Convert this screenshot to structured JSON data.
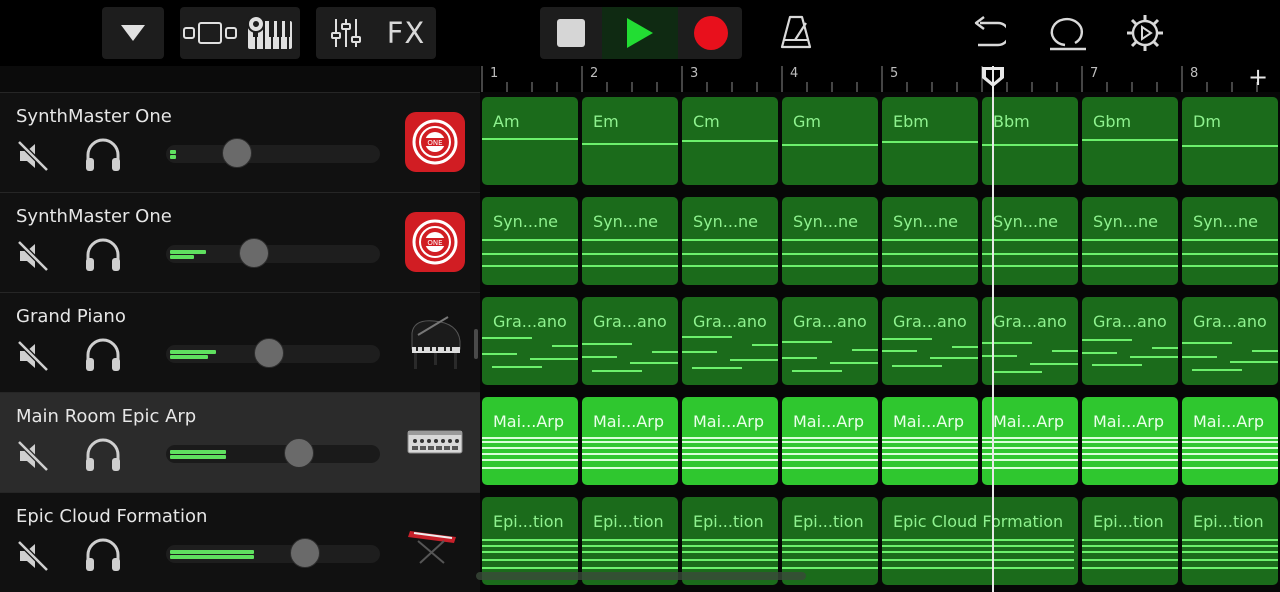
{
  "toolbar": {
    "fx_label": "FX",
    "colors": {
      "record": "#e8101c",
      "play": "#22dd33",
      "region": "#1b6b1b",
      "region_selected": "#2fc72f"
    }
  },
  "ruler": {
    "bars": [
      "1",
      "2",
      "3",
      "4",
      "5",
      "6",
      "7",
      "8"
    ],
    "add_label": "+"
  },
  "tracks": [
    {
      "name": "SynthMaster One",
      "icon": "synthmaster-one-icon",
      "selected": false,
      "volume": 0.33
    },
    {
      "name": "SynthMaster One",
      "icon": "synthmaster-one-icon",
      "selected": false,
      "volume": 0.41
    },
    {
      "name": "Grand Piano",
      "icon": "grand-piano-icon",
      "selected": false,
      "volume": 0.48
    },
    {
      "name": "Main Room Epic Arp",
      "icon": "synth-module-icon",
      "selected": true,
      "volume": 0.62
    },
    {
      "name": "Epic Cloud Formation",
      "icon": "keyboard-stand-icon",
      "selected": false,
      "volume": 0.65
    }
  ],
  "regions": [
    [
      "Am",
      "Em",
      "Cm",
      "Gm",
      "Ebm",
      "Bbm",
      "Gbm",
      "Dm"
    ],
    [
      "Syn...ne",
      "Syn...ne",
      "Syn...ne",
      "Syn...ne",
      "Syn...ne",
      "Syn...ne",
      "Syn...ne",
      "Syn...ne"
    ],
    [
      "Gra...ano",
      "Gra...ano",
      "Gra...ano",
      "Gra...ano",
      "Gra...ano",
      "Gra...ano",
      "Gra...ano",
      "Gra...ano"
    ],
    [
      "Mai...Arp",
      "Mai...Arp",
      "Mai...Arp",
      "Mai...Arp",
      "Mai...Arp",
      "Mai...Arp",
      "Mai...Arp",
      "Mai...Arp"
    ],
    [
      "Epi...tion",
      "Epi...tion",
      "Epi...tion",
      "Epi...tion",
      "Epic Cloud Formation",
      "Epi...tion",
      "Epi...tion"
    ]
  ],
  "playhead": {
    "bar": 6.1
  }
}
